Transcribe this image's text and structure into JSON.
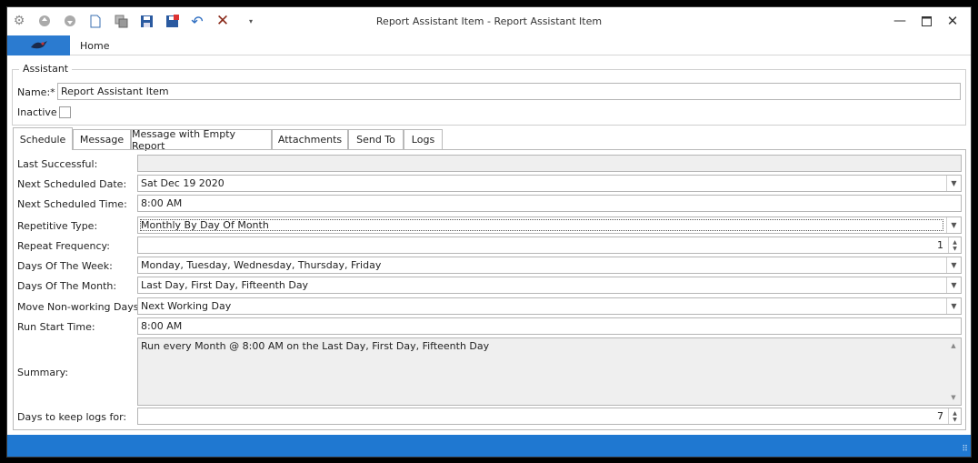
{
  "window": {
    "title": "Report Assistant Item - Report Assistant Item",
    "minimize_icon": "minimize-icon",
    "maximize_icon": "maximize-icon",
    "close_icon": "close-icon"
  },
  "quick_access": [
    "gear-icon",
    "up-circle-icon",
    "down-circle-icon",
    "new-document-icon",
    "copy-icon",
    "save-icon",
    "save-close-icon",
    "undo-icon",
    "delete-icon",
    "customize-dropdown-icon"
  ],
  "ribbon": {
    "home_tab": "Home"
  },
  "assistant": {
    "legend": "Assistant",
    "name_label": "Name:*",
    "name_value": "Report Assistant Item",
    "inactive_label": "Inactive",
    "inactive_checked": false
  },
  "tabs": [
    "Schedule",
    "Message",
    "Message with Empty Report",
    "Attachments",
    "Send To",
    "Logs"
  ],
  "schedule": {
    "last_successful": {
      "label": "Last Successful:",
      "value": ""
    },
    "next_date": {
      "label": "Next Scheduled Date:",
      "value": "Sat Dec 19 2020"
    },
    "next_time": {
      "label": "Next Scheduled Time:",
      "value": "8:00 AM"
    },
    "repetitive_type": {
      "label": "Repetitive Type:",
      "value": "Monthly By Day Of Month"
    },
    "repeat_frequency": {
      "label": "Repeat Frequency:",
      "value": "1"
    },
    "days_of_week": {
      "label": "Days Of The Week:",
      "value": "Monday, Tuesday, Wednesday, Thursday, Friday"
    },
    "days_of_month": {
      "label": "Days Of The Month:",
      "value": "Last Day, First Day, Fifteenth Day"
    },
    "move_nonworking": {
      "label": "Move Non-working Days:",
      "value": "Next Working Day"
    },
    "run_start_time": {
      "label": "Run Start Time:",
      "value": "8:00 AM"
    },
    "summary": {
      "label": "Summary:",
      "value": "Run every Month @ 8:00 AM on the Last Day, First Day, Fifteenth Day"
    },
    "days_keep_logs": {
      "label": "Days to keep logs for:",
      "value": "7"
    }
  },
  "colors": {
    "accent": "#1f78d1",
    "app_tab": "#2b7bd0"
  }
}
